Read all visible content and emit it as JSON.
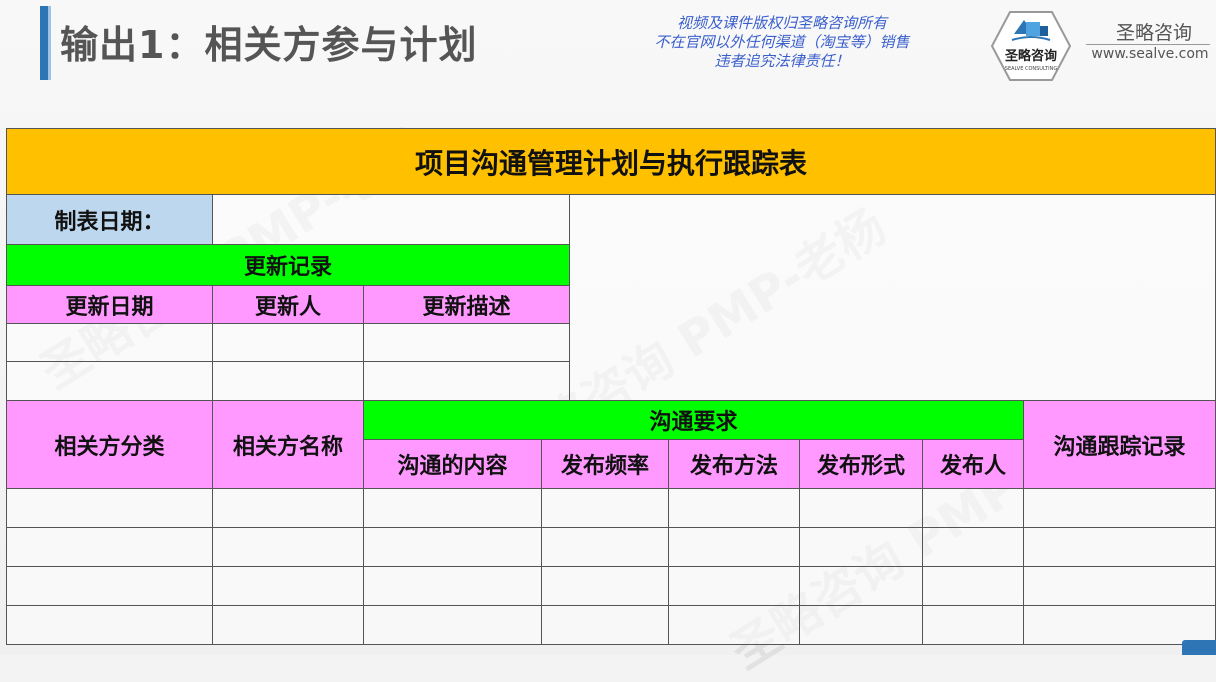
{
  "header": {
    "title": "输出1：相关方参与计划",
    "copyright_lines": [
      "视频及课件版权归圣略咨询所有",
      "不在官网以外任何渠道（淘宝等）销售",
      "违者追究法律责任！"
    ],
    "brand_name": "圣略咨询",
    "brand_url": "www.sealve.com",
    "logo_text": "圣略咨询",
    "logo_subtext": "SEALVE CONSULTING"
  },
  "watermark": "圣略咨询 PMP-老杨",
  "table": {
    "title": "项目沟通管理计划与执行跟踪表",
    "date_label": "制表日期：",
    "date_value": "",
    "update_record_header": "更新记录",
    "update_columns": [
      "更新日期",
      "更新人",
      "更新描述"
    ],
    "stakeholder_category": "相关方分类",
    "stakeholder_name": "相关方名称",
    "comm_requirements": "沟通要求",
    "comm_columns": [
      "沟通的内容",
      "发布频率",
      "发布方法",
      "发布形式",
      "发布人"
    ],
    "tracking_record": "沟通跟踪记录"
  },
  "colors": {
    "title_bg": "#ffc000",
    "date_label_bg": "#bdd7ee",
    "green_header": "#00ff00",
    "pink_header": "#ff99ff",
    "accent": "#2e75b6",
    "copyright_text": "#3a5fcd"
  }
}
